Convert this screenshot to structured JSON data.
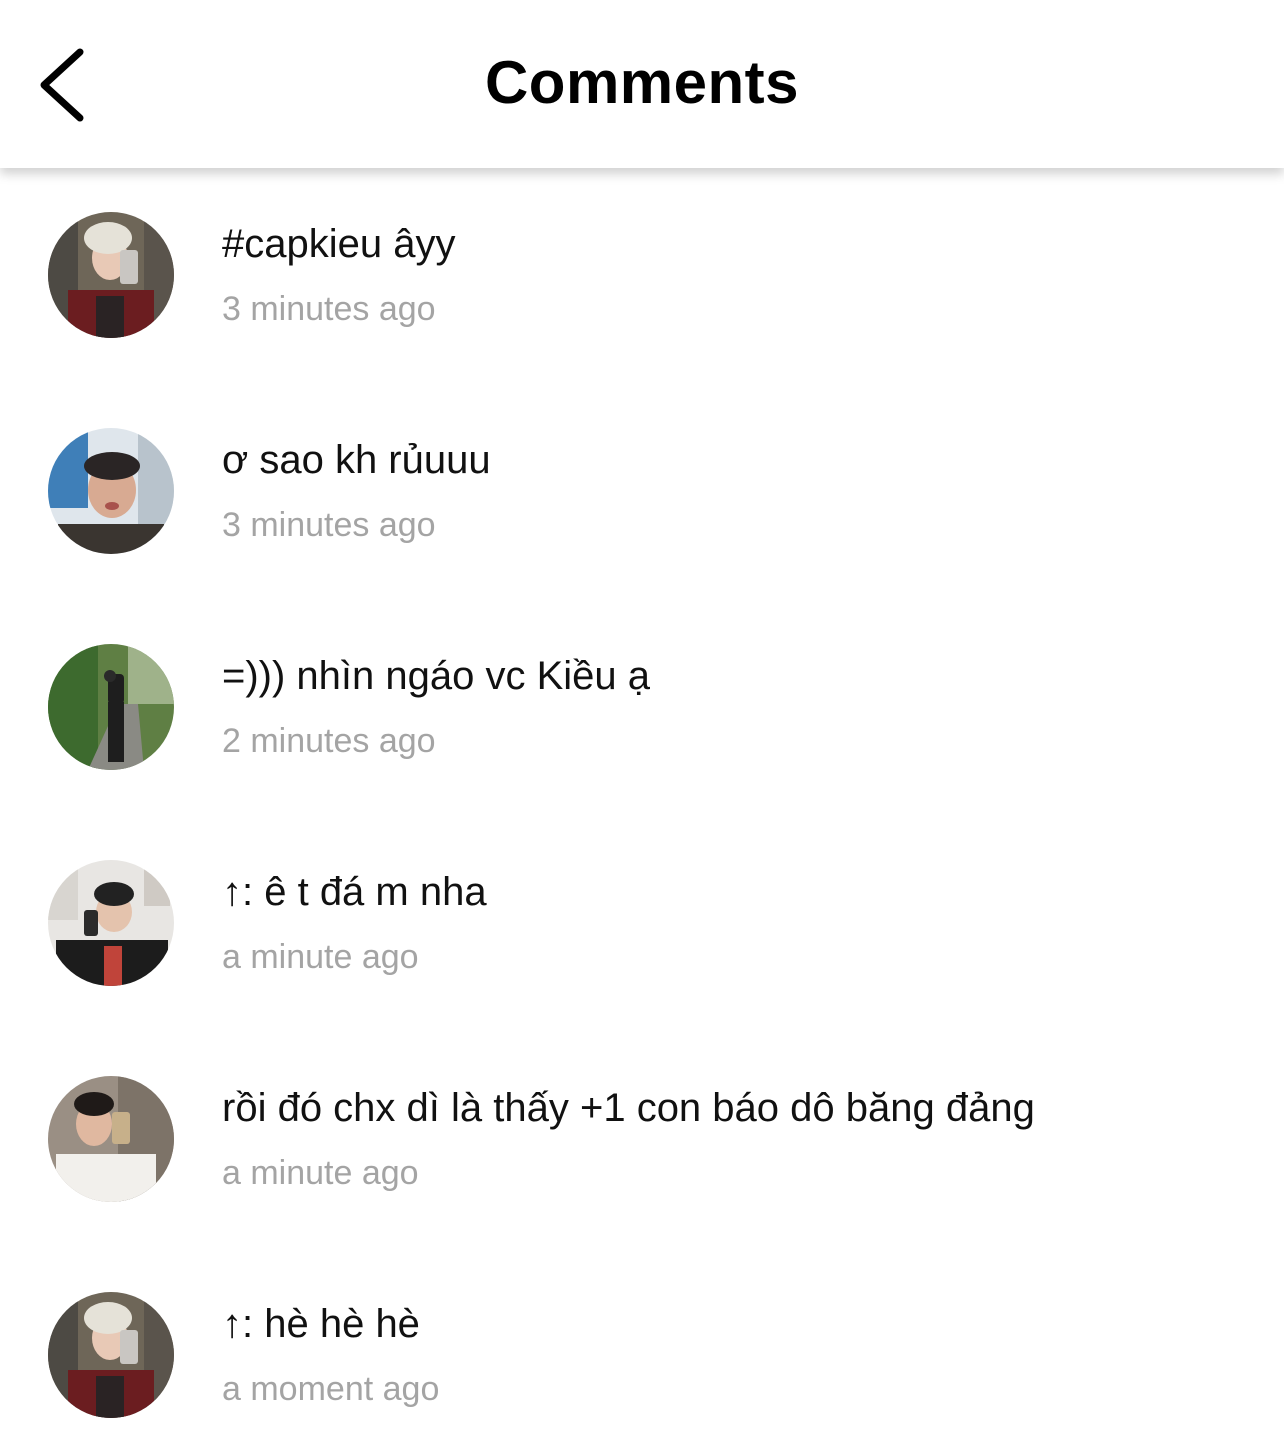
{
  "header": {
    "title": "Comments",
    "back_icon": "chevron-left-icon"
  },
  "comments": [
    {
      "text": "#capkieu âyy",
      "time": "3 minutes ago",
      "avatar": "avatar-blond-mirror-selfie"
    },
    {
      "text": "ơ sao kh rủuuu",
      "time": "3 minutes ago",
      "avatar": "avatar-pouting-selfie"
    },
    {
      "text": "=))) nhìn ngáo vc Kiều ạ",
      "time": "2 minutes ago",
      "avatar": "avatar-full-body-street"
    },
    {
      "text": "↑: ê t đá m nha",
      "time": "a minute ago",
      "avatar": "avatar-beanie-mirror-selfie"
    },
    {
      "text": "rồi đó chx dì là thấy +1 con báo dô băng đảng",
      "time": "a minute ago",
      "avatar": "avatar-white-shirt-mirror-selfie"
    },
    {
      "text": "↑: hè hè hè",
      "time": "a moment ago",
      "avatar": "avatar-blond-mirror-selfie"
    }
  ]
}
